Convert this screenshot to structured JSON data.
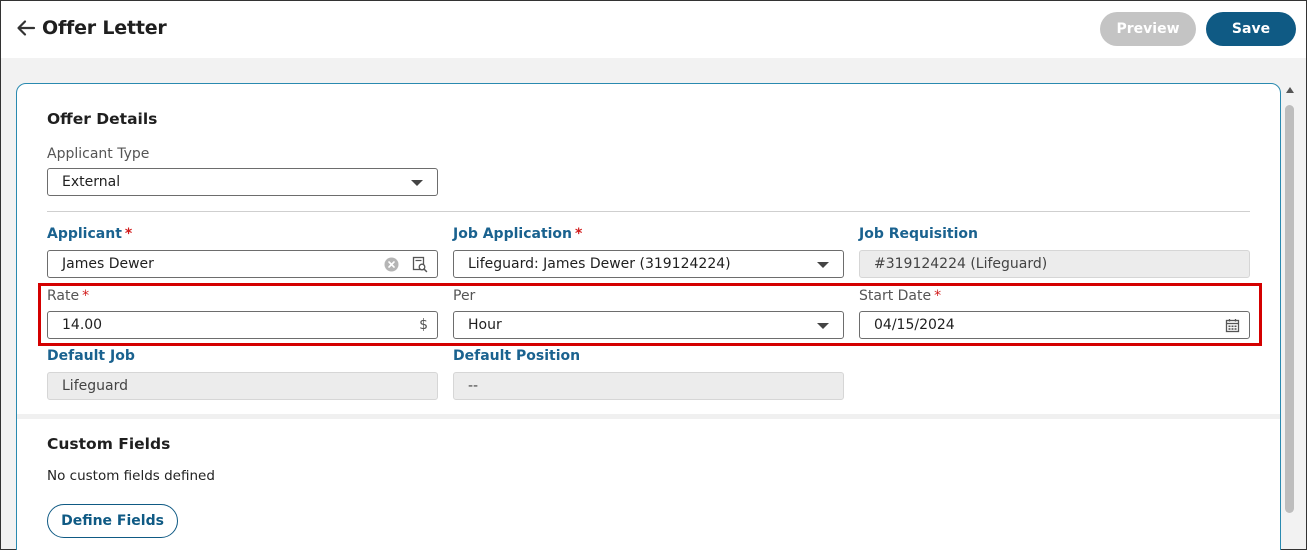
{
  "header": {
    "title": "Offer Letter",
    "preview_label": "Preview",
    "save_label": "Save"
  },
  "offer_details": {
    "heading": "Offer Details",
    "applicant_type": {
      "label": "Applicant Type",
      "value": "External"
    },
    "applicant": {
      "label": "Applicant",
      "required": "*",
      "value": "James Dewer"
    },
    "job_application": {
      "label": "Job Application",
      "required": "*",
      "value": "Lifeguard: James Dewer (319124224)"
    },
    "job_requisition": {
      "label": "Job Requisition",
      "value": "#319124224 (Lifeguard)"
    },
    "rate": {
      "label": "Rate",
      "required": "*",
      "value": "14.00",
      "suffix": "$"
    },
    "per": {
      "label": "Per",
      "value": "Hour"
    },
    "start_date": {
      "label": "Start Date",
      "required": "*",
      "value": "04/15/2024"
    },
    "default_job": {
      "label": "Default Job",
      "value": "Lifeguard"
    },
    "default_position": {
      "label": "Default Position",
      "value": "--"
    }
  },
  "custom_fields": {
    "heading": "Custom Fields",
    "empty_text": "No custom fields defined",
    "define_label": "Define Fields"
  },
  "colors": {
    "primary": "#0f5a84",
    "label_blue": "#1a628f",
    "required_red": "#d11a1a",
    "highlight_red": "#d40000",
    "disabled_button": "#c4c4c4"
  },
  "icons": [
    "back-arrow-icon",
    "clear-icon",
    "search-record-icon",
    "dropdown-caret-icon",
    "calendar-icon"
  ]
}
